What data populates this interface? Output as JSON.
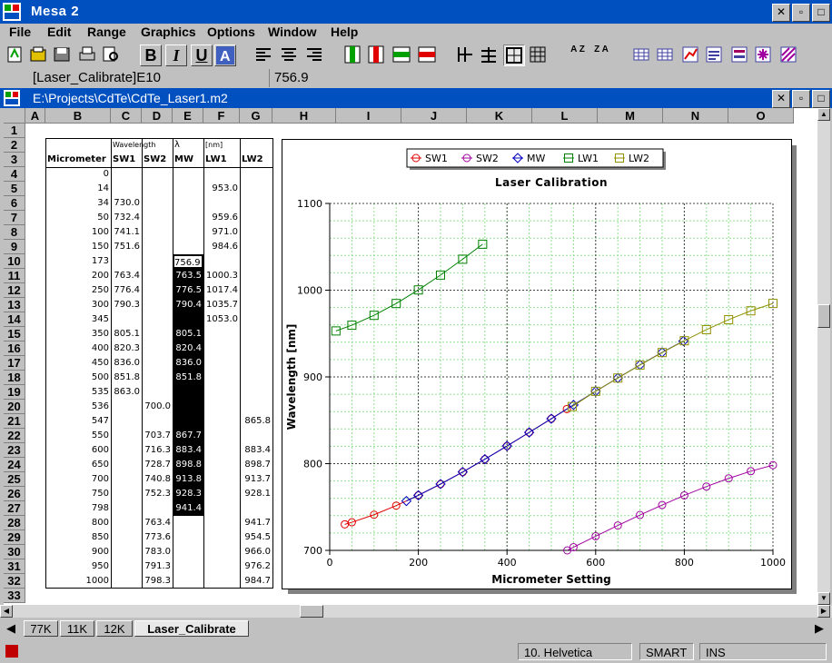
{
  "app": {
    "title": "Mesa 2"
  },
  "menu": [
    "File",
    "Edit",
    "Range",
    "Graphics",
    "Options",
    "Window",
    "Help"
  ],
  "toolbar": {
    "bold": "B",
    "italic": "I",
    "underline": "U",
    "sort_asc": "A Z",
    "sort_desc": "Z A"
  },
  "formula_bar": {
    "cell_ref": "[Laser_Calibrate]E10",
    "value": "756.9"
  },
  "document": {
    "path": "E:\\Projects\\CdTe\\CdTe_Laser1.m2"
  },
  "columns": [
    "A",
    "B",
    "C",
    "D",
    "E",
    "F",
    "G",
    "H",
    "I",
    "J",
    "K",
    "L",
    "M",
    "N",
    "O"
  ],
  "rows": [
    "1",
    "2",
    "3",
    "4",
    "5",
    "6",
    "7",
    "8",
    "9",
    "10",
    "11",
    "12",
    "13",
    "14",
    "15",
    "16",
    "17",
    "18",
    "19",
    "20",
    "21",
    "22",
    "23",
    "24",
    "25",
    "26",
    "27",
    "28",
    "29",
    "30",
    "31",
    "32",
    "33"
  ],
  "table": {
    "header_top": {
      "wavelength": "Wavelength",
      "lambda": "λ",
      "unit": "[nm]"
    },
    "headers": [
      "Micrometer",
      "SW1",
      "SW2",
      "MW",
      "LW1",
      "LW2"
    ],
    "data": [
      [
        "0",
        "",
        "",
        "",
        "",
        ""
      ],
      [
        "14",
        "",
        "",
        "",
        "953.0",
        ""
      ],
      [
        "34",
        "730.0",
        "",
        "",
        "",
        ""
      ],
      [
        "50",
        "732.4",
        "",
        "",
        "959.6",
        ""
      ],
      [
        "100",
        "741.1",
        "",
        "",
        "971.0",
        ""
      ],
      [
        "150",
        "751.6",
        "",
        "",
        "984.6",
        ""
      ],
      [
        "173",
        "",
        "",
        "756.9",
        "",
        ""
      ],
      [
        "200",
        "763.4",
        "",
        "763.5",
        "1000.3",
        ""
      ],
      [
        "250",
        "776.4",
        "",
        "776.5",
        "1017.4",
        ""
      ],
      [
        "300",
        "790.3",
        "",
        "790.4",
        "1035.7",
        ""
      ],
      [
        "345",
        "",
        "",
        "",
        "1053.0",
        ""
      ],
      [
        "350",
        "805.1",
        "",
        "805.1",
        "",
        ""
      ],
      [
        "400",
        "820.3",
        "",
        "820.4",
        "",
        ""
      ],
      [
        "450",
        "836.0",
        "",
        "836.0",
        "",
        ""
      ],
      [
        "500",
        "851.8",
        "",
        "851.8",
        "",
        ""
      ],
      [
        "535",
        "863.0",
        "",
        "",
        "",
        ""
      ],
      [
        "536",
        "",
        "700.0",
        "",
        "",
        ""
      ],
      [
        "547",
        "",
        "",
        "",
        "",
        "865.8"
      ],
      [
        "550",
        "",
        "703.7",
        "867.7",
        "",
        ""
      ],
      [
        "600",
        "",
        "716.3",
        "883.4",
        "",
        "883.4"
      ],
      [
        "650",
        "",
        "728.7",
        "898.8",
        "",
        "898.7"
      ],
      [
        "700",
        "",
        "740.8",
        "913.8",
        "",
        "913.7"
      ],
      [
        "750",
        "",
        "752.3",
        "928.3",
        "",
        "928.1"
      ],
      [
        "798",
        "",
        "",
        "941.4",
        "",
        ""
      ],
      [
        "800",
        "",
        "763.4",
        "",
        "",
        "941.7"
      ],
      [
        "850",
        "",
        "773.6",
        "",
        "",
        "954.5"
      ],
      [
        "900",
        "",
        "783.0",
        "",
        "",
        "966.0"
      ],
      [
        "950",
        "",
        "791.3",
        "",
        "",
        "976.2"
      ],
      [
        "1000",
        "",
        "798.3",
        "",
        "",
        "984.7"
      ]
    ]
  },
  "chart_data": {
    "type": "line",
    "title": "Laser Calibration",
    "xlabel": "Micrometer Setting",
    "ylabel": "Wavelength [nm]",
    "xlim": [
      0,
      1000
    ],
    "ylim": [
      700,
      1100
    ],
    "xticks": [
      "0",
      "200",
      "400",
      "600",
      "800",
      "1000"
    ],
    "yticks": [
      "700",
      "800",
      "900",
      "1000",
      "1100"
    ],
    "grid": true,
    "legend": "top",
    "series": [
      {
        "name": "SW1",
        "color": "#e00000",
        "marker": "circle",
        "x": [
          34,
          50,
          100,
          150,
          200,
          250,
          300,
          350,
          400,
          450,
          500,
          535
        ],
        "y": [
          730.0,
          732.4,
          741.1,
          751.6,
          763.4,
          776.4,
          790.3,
          805.1,
          820.3,
          836.0,
          851.8,
          863.0
        ]
      },
      {
        "name": "SW2",
        "color": "#a000a0",
        "marker": "circle",
        "x": [
          536,
          550,
          600,
          650,
          700,
          750,
          800,
          850,
          900,
          950,
          1000
        ],
        "y": [
          700.0,
          703.7,
          716.3,
          728.7,
          740.8,
          752.3,
          763.4,
          773.6,
          783.0,
          791.3,
          798.3
        ]
      },
      {
        "name": "MW",
        "color": "#0000c0",
        "marker": "diamond",
        "x": [
          173,
          200,
          250,
          300,
          350,
          400,
          450,
          500,
          550,
          600,
          650,
          700,
          750,
          798
        ],
        "y": [
          756.9,
          763.5,
          776.5,
          790.4,
          805.1,
          820.4,
          836.0,
          851.8,
          867.7,
          883.4,
          898.8,
          913.8,
          928.3,
          941.4
        ]
      },
      {
        "name": "LW1",
        "color": "#008000",
        "marker": "square",
        "x": [
          14,
          50,
          100,
          150,
          200,
          250,
          300,
          345
        ],
        "y": [
          953.0,
          959.6,
          971.0,
          984.6,
          1000.3,
          1017.4,
          1035.7,
          1053.0
        ]
      },
      {
        "name": "LW2",
        "color": "#909000",
        "marker": "square",
        "x": [
          547,
          600,
          650,
          700,
          750,
          800,
          850,
          900,
          950,
          1000
        ],
        "y": [
          865.8,
          883.4,
          898.7,
          913.7,
          928.1,
          941.7,
          954.5,
          966.0,
          976.2,
          984.7
        ]
      }
    ]
  },
  "tabs": [
    "77K",
    "11K",
    "12K",
    "Laser_Calibrate"
  ],
  "status": {
    "font": "10. Helvetica",
    "mode": "SMART",
    "insert": "INS"
  }
}
